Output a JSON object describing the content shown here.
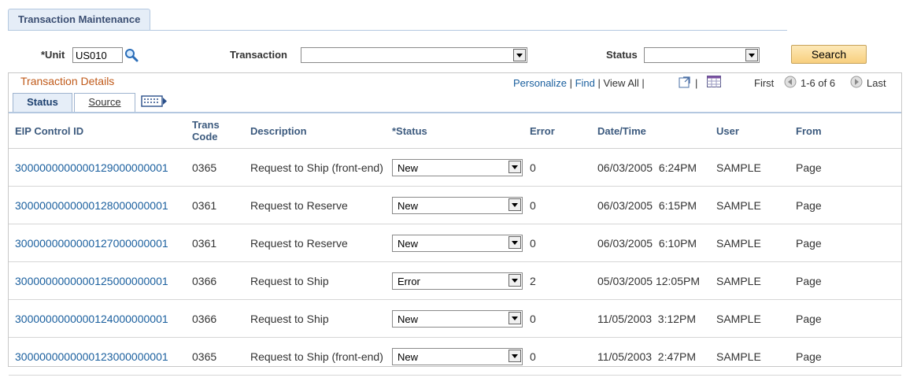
{
  "page": {
    "tab_title": "Transaction Maintenance"
  },
  "filters": {
    "unit_label": "*Unit",
    "unit_value": "US010",
    "transaction_label": "Transaction",
    "transaction_value": "",
    "status_label": "Status",
    "status_value": "",
    "search_label": "Search"
  },
  "grid": {
    "title": "Transaction Details",
    "personalize": "Personalize",
    "find": "Find",
    "view_all": "View All",
    "first": "First",
    "range": "1-6 of 6",
    "last": "Last",
    "tabs": {
      "status": "Status",
      "source": "Source"
    },
    "columns": {
      "eip": "EIP Control ID",
      "trans": "Trans Code",
      "desc": "Description",
      "status": "*Status",
      "error": "Error",
      "datetime": "Date/Time",
      "user": "User",
      "from": "From"
    },
    "rows": [
      {
        "eip": "3000000000000129000000001",
        "trans": "0365",
        "desc": "Request to Ship (front-end)",
        "status": "New",
        "error": "0",
        "datetime": "06/03/2005  6:24PM",
        "user": "SAMPLE",
        "from": "Page"
      },
      {
        "eip": "3000000000000128000000001",
        "trans": "0361",
        "desc": "Request to Reserve",
        "status": "New",
        "error": "0",
        "datetime": "06/03/2005  6:15PM",
        "user": "SAMPLE",
        "from": "Page"
      },
      {
        "eip": "3000000000000127000000001",
        "trans": "0361",
        "desc": "Request to Reserve",
        "status": "New",
        "error": "0",
        "datetime": "06/03/2005  6:10PM",
        "user": "SAMPLE",
        "from": "Page"
      },
      {
        "eip": "3000000000000125000000001",
        "trans": "0366",
        "desc": "Request to Ship",
        "status": "Error",
        "error": "2",
        "datetime": "05/03/2005 12:05PM",
        "user": "SAMPLE",
        "from": "Page"
      },
      {
        "eip": "3000000000000124000000001",
        "trans": "0366",
        "desc": "Request to Ship",
        "status": "New",
        "error": "0",
        "datetime": "11/05/2003  3:12PM",
        "user": "SAMPLE",
        "from": "Page"
      },
      {
        "eip": "3000000000000123000000001",
        "trans": "0365",
        "desc": "Request to Ship (front-end)",
        "status": "New",
        "error": "0",
        "datetime": "11/05/2003  2:47PM",
        "user": "SAMPLE",
        "from": "Page"
      }
    ]
  },
  "icons": {
    "lookup": "magnifier-icon",
    "zoom": "zoom-grid-icon",
    "download": "download-spreadsheet-icon",
    "first_arrow": "left-arrow-icon",
    "next_arrow": "right-arrow-icon",
    "show_all_columns": "show-all-columns-icon"
  },
  "colors": {
    "link": "#1a5f9e",
    "grid_title": "#c05a1a",
    "search_button": "#f8cf7e"
  }
}
